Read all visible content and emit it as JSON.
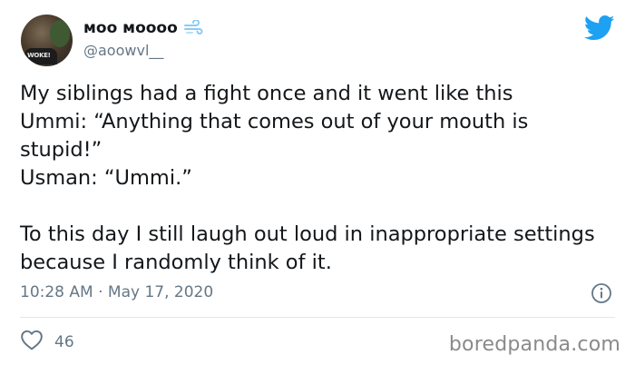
{
  "author": {
    "display_name": "ᴍᴏᴏ ᴍᴏᴏᴏᴏ",
    "handle": "@aoowvl__",
    "avatar_shirt_text": "WOKE!",
    "name_emoji": "dash-symbol-icon"
  },
  "tweet": {
    "text": "My siblings had a fight once and it went like this\nUmmi: “Anything that comes out of your mouth is stupid!”\nUsman: “Ummi.”\n\nTo this day I still laugh out loud in inappropriate settings because I randomly think of it.",
    "timestamp": "10:28 AM · May 17, 2020",
    "likes": "46"
  },
  "icons": {
    "brand": "twitter-bird-icon",
    "info": "info-icon",
    "like": "heart-icon"
  },
  "watermark": "boredpanda.com",
  "colors": {
    "twitter_blue": "#1da1f2",
    "text_primary": "#14171a",
    "text_secondary": "#657786",
    "divider": "#e1e8ed"
  }
}
